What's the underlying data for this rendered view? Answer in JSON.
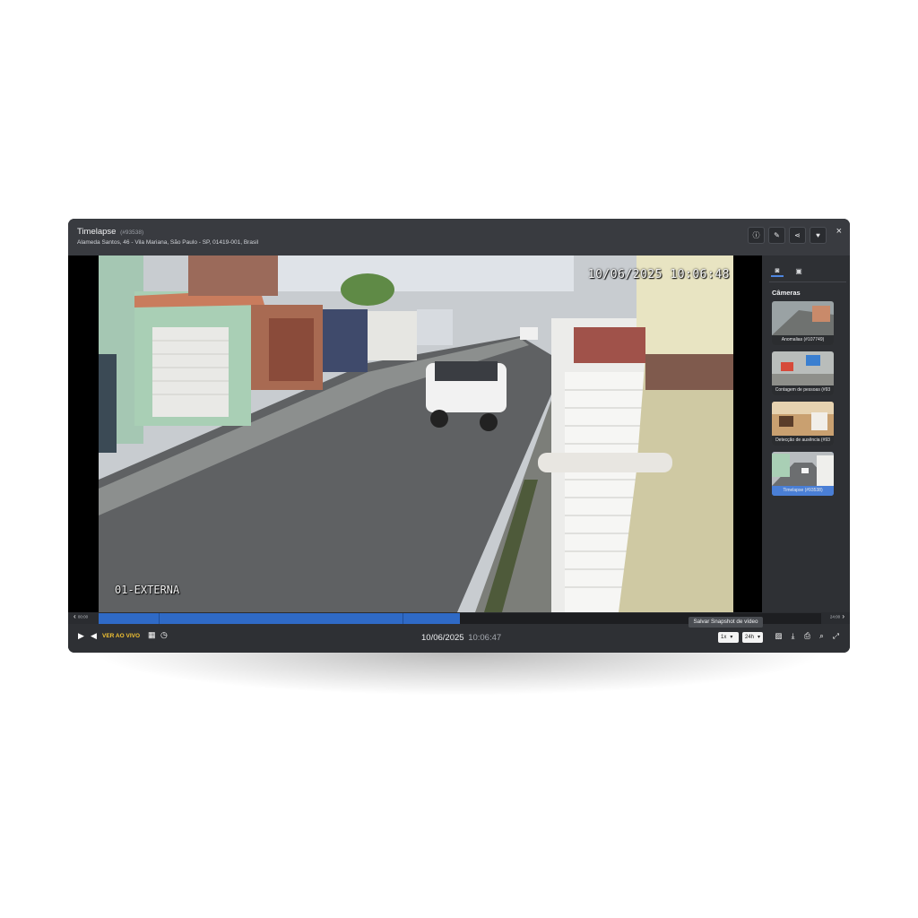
{
  "window": {
    "title": "Timelapse",
    "title_id": "(#93538)",
    "address": "Alameda Santos, 46 - Vila Mariana, São Paulo - SP, 01419-001, Brasil",
    "header_icons": [
      "info-icon",
      "edit-icon",
      "share-icon",
      "heart-icon"
    ],
    "close": "×"
  },
  "video": {
    "overlay_timestamp": "10/06/2025 10:06:48",
    "overlay_camera": "01-EXTERNA"
  },
  "sidebar": {
    "tabs": [
      "camera-icon",
      "image-icon"
    ],
    "title": "Câmeras",
    "cameras": [
      {
        "label": "Anomalias (#107749)",
        "selected": false
      },
      {
        "label": "Contagem de pessoas (#93",
        "selected": false
      },
      {
        "label": "Detecção de ausência (#93",
        "selected": false
      },
      {
        "label": "Timelapse (#93538)",
        "selected": true
      }
    ]
  },
  "timeline": {
    "start_label": "00:00",
    "end_label": "24:00",
    "progress_fraction": 0.5
  },
  "controls": {
    "live_label": "VER AO VIVO",
    "date": "10/06/2025",
    "time": "10:06:47",
    "speed": "1x",
    "range": "24h",
    "tooltip": "Salvar Snapshot de vídeo",
    "colors": {
      "accent": "#2f6ac6",
      "live": "#f2c232",
      "background": "#2e3034"
    }
  }
}
